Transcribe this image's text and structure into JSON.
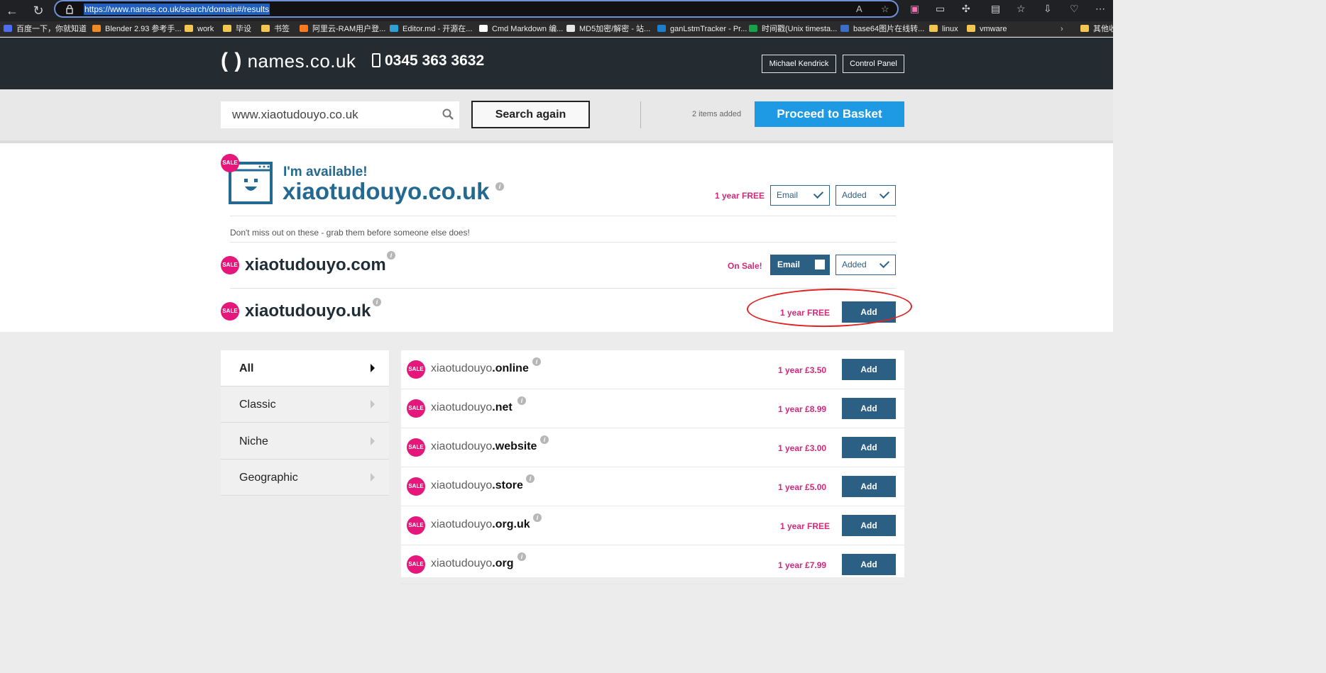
{
  "browser": {
    "url": "https://www.names.co.uk/search/domain#/results",
    "bookmarks": [
      {
        "label": "百度一下，你就知道"
      },
      {
        "label": "Blender 2.93 参考手..."
      },
      {
        "label": "work"
      },
      {
        "label": "毕设"
      },
      {
        "label": "书签"
      },
      {
        "label": "阿里云-RAM用户登..."
      },
      {
        "label": "Editor.md - 开源在..."
      },
      {
        "label": "Cmd Markdown 编..."
      },
      {
        "label": "MD5加密/解密 - 站..."
      },
      {
        "label": "ganLstmTracker - Pr..."
      },
      {
        "label": "时间戳(Unix timesta..."
      },
      {
        "label": "base64图片在线转..."
      },
      {
        "label": "linux"
      },
      {
        "label": "vmware"
      },
      {
        "label": "其他收"
      }
    ]
  },
  "site": {
    "logo_brackets": "(  )",
    "logo_text": "names.co.uk",
    "phone": "0345 363 3632",
    "user_button": "Michael Kendrick",
    "control_panel_button": "Control Panel"
  },
  "search": {
    "value": "www.xiaotudouyo.co.uk",
    "search_again": "Search again",
    "items_added": "2 items added",
    "proceed": "Proceed to Basket"
  },
  "featured": {
    "sale": "SALE",
    "title": "I'm available!",
    "domain": "xiaotudouyo.co.uk",
    "promo": "1 year FREE",
    "email_label": "Email",
    "added_label": "Added",
    "suggestion_text": "Don't miss out on these - grab them before someone else does!"
  },
  "recommended": [
    {
      "sale": "SALE",
      "name": "xiaotudouyo.com",
      "promo": "On Sale!",
      "email_label": "Email",
      "added_label": "Added"
    },
    {
      "sale": "SALE",
      "name": "xiaotudouyo.uk",
      "promo": "1 year FREE",
      "add_label": "Add"
    }
  ],
  "categories": [
    {
      "label": "All"
    },
    {
      "label": "Classic"
    },
    {
      "label": "Niche"
    },
    {
      "label": "Geographic"
    }
  ],
  "results": [
    {
      "sale": "SALE",
      "base": "xiaotudouyo",
      "tld": ".online",
      "price": "1 year £3.50",
      "button": "Add"
    },
    {
      "sale": "SALE",
      "base": "xiaotudouyo",
      "tld": ".net",
      "price": "1 year £8.99",
      "button": "Add"
    },
    {
      "sale": "SALE",
      "base": "xiaotudouyo",
      "tld": ".website",
      "price": "1 year £3.00",
      "button": "Add"
    },
    {
      "sale": "SALE",
      "base": "xiaotudouyo",
      "tld": ".store",
      "price": "1 year £5.00",
      "button": "Add"
    },
    {
      "sale": "SALE",
      "base": "xiaotudouyo",
      "tld": ".org.uk",
      "price": "1 year FREE",
      "button": "Add"
    },
    {
      "sale": "SALE",
      "base": "xiaotudouyo",
      "tld": ".org",
      "price": "1 year £7.99",
      "button": "Add"
    }
  ],
  "info_symbol": "i",
  "colors": {
    "brand_blue": "#236991",
    "sale_pink": "#e5177a",
    "button_blue": "#2b5f84",
    "proceed_blue": "#1e9ae5",
    "annotation_red": "#e12222"
  },
  "icons": {
    "back": "back-arrow-icon",
    "refresh": "refresh-icon",
    "lock": "lock-icon",
    "search": "search-icon",
    "phone": "phone-icon",
    "check": "check-icon",
    "info": "info-icon"
  }
}
